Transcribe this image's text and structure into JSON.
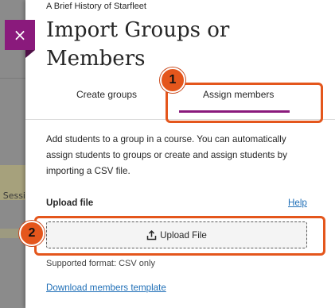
{
  "background": {
    "partial_text": "Sessi"
  },
  "close_button": {
    "glyph": "×"
  },
  "panel": {
    "breadcrumb": "A Brief History of Starfleet",
    "title": "Import Groups or Members",
    "tabs": [
      {
        "label": "Create groups",
        "active": false
      },
      {
        "label": "Assign members",
        "active": true
      }
    ],
    "description": "Add students to a group in a course. You can automatically assign students to groups or create and assign students by importing a CSV file.",
    "upload_label": "Upload file",
    "help_link": "Help",
    "upload_button": "Upload File",
    "supported_format": "Supported format: CSV only",
    "download_link": "Download members template"
  },
  "callouts": [
    {
      "number": "1"
    },
    {
      "number": "2"
    }
  ],
  "colors": {
    "accent": "#8a1a7c",
    "link": "#1f6fb7",
    "callout": "#e4561c"
  }
}
